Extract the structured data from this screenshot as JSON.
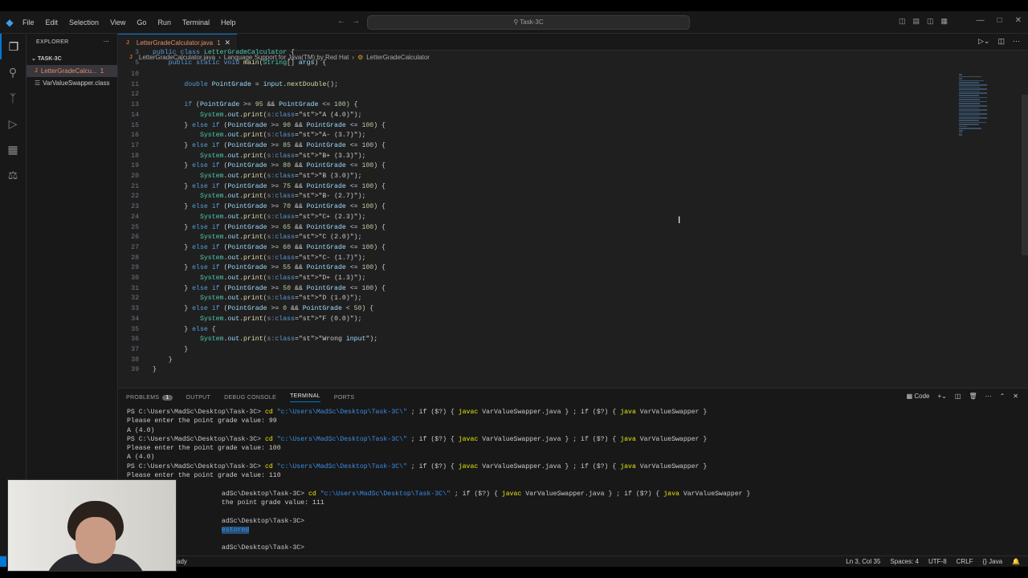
{
  "titlebar": {
    "menu": [
      "File",
      "Edit",
      "Selection",
      "View",
      "Go",
      "Run",
      "Terminal",
      "Help"
    ],
    "search_text": "Task-3C"
  },
  "sidebar": {
    "header": "EXPLORER",
    "folder": "TASK-3C",
    "files": [
      {
        "name": "LetterGradeCalcu...",
        "badge": "1",
        "active": true
      },
      {
        "name": "VarValueSwapper.class",
        "badge": "",
        "active": false
      }
    ]
  },
  "editor": {
    "tab_label": "LetterGradeCalculator.java",
    "tab_badge": "1",
    "breadcrumbs": [
      "LetterGradeCalculator.java",
      "Language Support for Java(TM) by Red Hat",
      "LetterGradeCalculator"
    ],
    "sticky_lines": [
      {
        "n": "3",
        "code": "public class LetterGradeCalculator {"
      },
      {
        "n": "5",
        "code": "    public static void main(String[] args) {"
      }
    ],
    "lines": [
      {
        "n": "10",
        "code": ""
      },
      {
        "n": "11",
        "code": "        double PointGrade = input.nextDouble();"
      },
      {
        "n": "12",
        "code": ""
      },
      {
        "n": "13",
        "code": "        if (PointGrade >= 95 && PointGrade <= 100) {"
      },
      {
        "n": "14",
        "code": "            System.out.print(s:\"A (4.0)\");"
      },
      {
        "n": "15",
        "code": "        } else if (PointGrade >= 90 && PointGrade <= 100) {"
      },
      {
        "n": "16",
        "code": "            System.out.print(s:\"A- (3.7)\");"
      },
      {
        "n": "17",
        "code": "        } else if (PointGrade >= 85 && PointGrade <= 100) {"
      },
      {
        "n": "18",
        "code": "            System.out.print(s:\"B+ (3.3)\");"
      },
      {
        "n": "19",
        "code": "        } else if (PointGrade >= 80 && PointGrade <= 100) {"
      },
      {
        "n": "20",
        "code": "            System.out.print(s:\"B (3.0)\");"
      },
      {
        "n": "21",
        "code": "        } else if (PointGrade >= 75 && PointGrade <= 100) {"
      },
      {
        "n": "22",
        "code": "            System.out.print(s:\"B- (2.7)\");"
      },
      {
        "n": "23",
        "code": "        } else if (PointGrade >= 70 && PointGrade <= 100) {"
      },
      {
        "n": "24",
        "code": "            System.out.print(s:\"C+ (2.3)\");"
      },
      {
        "n": "25",
        "code": "        } else if (PointGrade >= 65 && PointGrade <= 100) {"
      },
      {
        "n": "26",
        "code": "            System.out.print(s:\"C (2.0)\");"
      },
      {
        "n": "27",
        "code": "        } else if (PointGrade >= 60 && PointGrade <= 100) {"
      },
      {
        "n": "28",
        "code": "            System.out.print(s:\"C- (1.7)\");"
      },
      {
        "n": "29",
        "code": "        } else if (PointGrade >= 55 && PointGrade <= 100) {"
      },
      {
        "n": "30",
        "code": "            System.out.print(s:\"D+ (1.3)\");"
      },
      {
        "n": "31",
        "code": "        } else if (PointGrade >= 50 && PointGrade <= 100) {"
      },
      {
        "n": "32",
        "code": "            System.out.print(s:\"D (1.0)\");"
      },
      {
        "n": "33",
        "code": "        } else if (PointGrade >= 0 && PointGrade < 50) {"
      },
      {
        "n": "34",
        "code": "            System.out.print(s:\"F (0.0)\");"
      },
      {
        "n": "35",
        "code": "        } else {"
      },
      {
        "n": "36",
        "code": "            System.out.print(s:\"Wrong input\");"
      },
      {
        "n": "37",
        "code": "        }"
      },
      {
        "n": "38",
        "code": "    }"
      },
      {
        "n": "39",
        "code": "}"
      }
    ]
  },
  "panel": {
    "tabs": [
      "PROBLEMS",
      "OUTPUT",
      "DEBUG CONSOLE",
      "TERMINAL",
      "PORTS"
    ],
    "problems_count": "1",
    "active_tab": "TERMINAL",
    "terminal_label": "Code",
    "terminal_lines": [
      "PS C:\\Users\\MadSc\\Desktop\\Task-3C> cd \"c:\\Users\\MadSc\\Desktop\\Task-3C\\\" ; if ($?) { javac VarValueSwapper.java } ; if ($?) { java VarValueSwapper }",
      "Please enter the point grade value: 99",
      "A (4.0)",
      "PS C:\\Users\\MadSc\\Desktop\\Task-3C> cd \"c:\\Users\\MadSc\\Desktop\\Task-3C\\\" ; if ($?) { javac VarValueSwapper.java } ; if ($?) { java VarValueSwapper }",
      "Please enter the point grade value: 100",
      "A (4.0)",
      "PS C:\\Users\\MadSc\\Desktop\\Task-3C> cd \"c:\\Users\\MadSc\\Desktop\\Task-3C\\\" ; if ($?) { javac VarValueSwapper.java } ; if ($?) { java VarValueSwapper }",
      "Please enter the point grade value: 110",
      "",
      "                        adSc\\Desktop\\Task-3C> cd \"c:\\Users\\MadSc\\Desktop\\Task-3C\\\" ; if ($?) { javac VarValueSwapper.java } ; if ($?) { java VarValueSwapper }",
      "                        the point grade value: 111",
      "",
      "                        adSc\\Desktop\\Task-3C>",
      "                        estored",
      "",
      "                        adSc\\Desktop\\Task-3C>"
    ]
  },
  "statusbar": {
    "ready": "ady",
    "position": "Ln 3, Col 35",
    "spaces": "Spaces: 4",
    "encoding": "UTF-8",
    "eol": "CRLF",
    "language": "Java"
  },
  "colors": {
    "accent": "#0078d4",
    "java_icon": "#e2662c",
    "modified_file": "#e98b65"
  }
}
